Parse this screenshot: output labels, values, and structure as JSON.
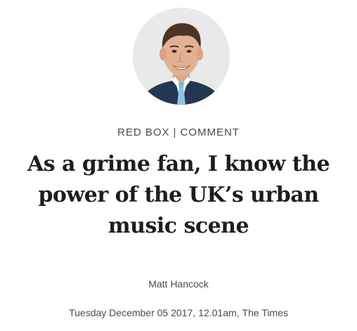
{
  "article": {
    "section": "RED BOX",
    "separator": "|",
    "category": "COMMENT",
    "headline": "As a grime fan, I know the power of the UK’s urban music scene",
    "author": "Matt Hancock",
    "date": "Tuesday December 05 2017",
    "time": "12.01am",
    "publication": "The Times"
  },
  "colors": {
    "text": "#1d1d1b",
    "secondary_text": "#4a4a4a",
    "avatar_background": "#e6e6e6",
    "suit": "#243752",
    "shirt": "#ffffff",
    "tie": "#8fc3e6"
  }
}
